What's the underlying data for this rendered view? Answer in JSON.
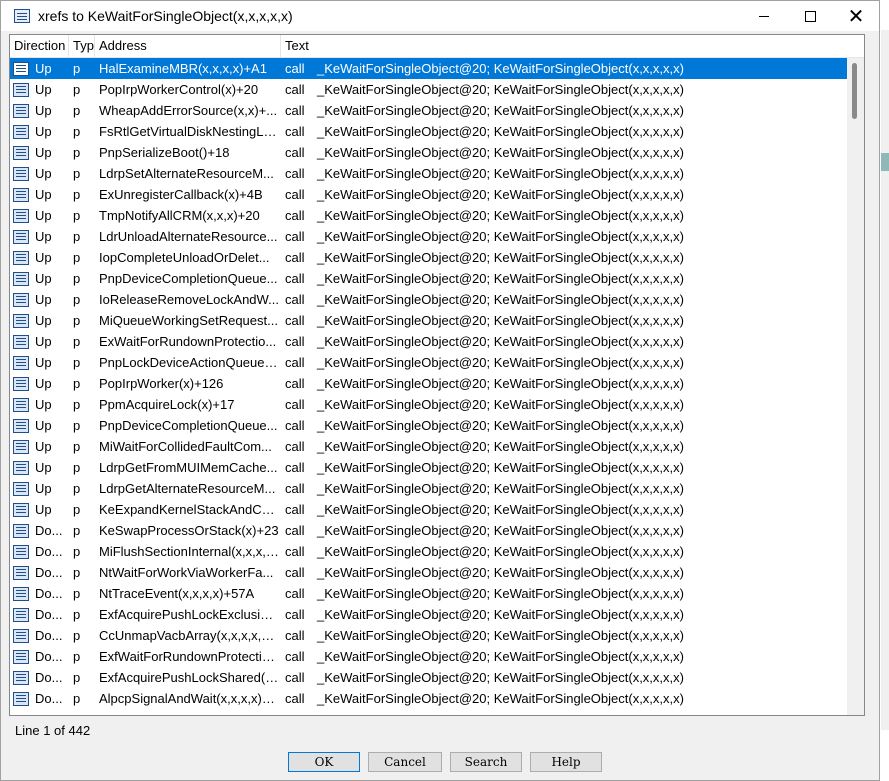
{
  "window": {
    "title": "xrefs to KeWaitForSingleObject(x,x,x,x,x)"
  },
  "columns": {
    "direction": "Direction",
    "type": "Typ",
    "address": "Address",
    "text": "Text"
  },
  "rows": [
    {
      "dir": "Up",
      "type": "p",
      "address": "HalExamineMBR(x,x,x,x)+A1",
      "kind": "call",
      "text": "_KeWaitForSingleObject@20; KeWaitForSingleObject(x,x,x,x,x)"
    },
    {
      "dir": "Up",
      "type": "p",
      "address": "PopIrpWorkerControl(x)+20",
      "kind": "call",
      "text": "_KeWaitForSingleObject@20; KeWaitForSingleObject(x,x,x,x,x)"
    },
    {
      "dir": "Up",
      "type": "p",
      "address": "WheapAddErrorSource(x,x)+...",
      "kind": "call",
      "text": "_KeWaitForSingleObject@20; KeWaitForSingleObject(x,x,x,x,x)"
    },
    {
      "dir": "Up",
      "type": "p",
      "address": "FsRtlGetVirtualDiskNestingLe...",
      "kind": "call",
      "text": "_KeWaitForSingleObject@20; KeWaitForSingleObject(x,x,x,x,x)"
    },
    {
      "dir": "Up",
      "type": "p",
      "address": "PnpSerializeBoot()+18",
      "kind": "call",
      "text": "_KeWaitForSingleObject@20; KeWaitForSingleObject(x,x,x,x,x)"
    },
    {
      "dir": "Up",
      "type": "p",
      "address": "LdrpSetAlternateResourceM...",
      "kind": "call",
      "text": "_KeWaitForSingleObject@20; KeWaitForSingleObject(x,x,x,x,x)"
    },
    {
      "dir": "Up",
      "type": "p",
      "address": "ExUnregisterCallback(x)+4B",
      "kind": "call",
      "text": "_KeWaitForSingleObject@20; KeWaitForSingleObject(x,x,x,x,x)"
    },
    {
      "dir": "Up",
      "type": "p",
      "address": "TmpNotifyAllCRM(x,x,x)+20",
      "kind": "call",
      "text": "_KeWaitForSingleObject@20; KeWaitForSingleObject(x,x,x,x,x)"
    },
    {
      "dir": "Up",
      "type": "p",
      "address": "LdrUnloadAlternateResource...",
      "kind": "call",
      "text": "_KeWaitForSingleObject@20; KeWaitForSingleObject(x,x,x,x,x)"
    },
    {
      "dir": "Up",
      "type": "p",
      "address": "IopCompleteUnloadOrDelet...",
      "kind": "call",
      "text": "_KeWaitForSingleObject@20; KeWaitForSingleObject(x,x,x,x,x)"
    },
    {
      "dir": "Up",
      "type": "p",
      "address": "PnpDeviceCompletionQueue...",
      "kind": "call",
      "text": "_KeWaitForSingleObject@20; KeWaitForSingleObject(x,x,x,x,x)"
    },
    {
      "dir": "Up",
      "type": "p",
      "address": "IoReleaseRemoveLockAndW...",
      "kind": "call",
      "text": "_KeWaitForSingleObject@20; KeWaitForSingleObject(x,x,x,x,x)"
    },
    {
      "dir": "Up",
      "type": "p",
      "address": "MiQueueWorkingSetRequest...",
      "kind": "call",
      "text": "_KeWaitForSingleObject@20; KeWaitForSingleObject(x,x,x,x,x)"
    },
    {
      "dir": "Up",
      "type": "p",
      "address": "ExWaitForRundownProtectio...",
      "kind": "call",
      "text": "_KeWaitForSingleObject@20; KeWaitForSingleObject(x,x,x,x,x)"
    },
    {
      "dir": "Up",
      "type": "p",
      "address": "PnpLockDeviceActionQueue(...",
      "kind": "call",
      "text": "_KeWaitForSingleObject@20; KeWaitForSingleObject(x,x,x,x,x)"
    },
    {
      "dir": "Up",
      "type": "p",
      "address": "PopIrpWorker(x)+126",
      "kind": "call",
      "text": "_KeWaitForSingleObject@20; KeWaitForSingleObject(x,x,x,x,x)"
    },
    {
      "dir": "Up",
      "type": "p",
      "address": "PpmAcquireLock(x)+17",
      "kind": "call",
      "text": "_KeWaitForSingleObject@20; KeWaitForSingleObject(x,x,x,x,x)"
    },
    {
      "dir": "Up",
      "type": "p",
      "address": "PnpDeviceCompletionQueue...",
      "kind": "call",
      "text": "_KeWaitForSingleObject@20; KeWaitForSingleObject(x,x,x,x,x)"
    },
    {
      "dir": "Up",
      "type": "p",
      "address": "MiWaitForCollidedFaultCom...",
      "kind": "call",
      "text": "_KeWaitForSingleObject@20; KeWaitForSingleObject(x,x,x,x,x)"
    },
    {
      "dir": "Up",
      "type": "p",
      "address": "LdrpGetFromMUIMemCache...",
      "kind": "call",
      "text": "_KeWaitForSingleObject@20; KeWaitForSingleObject(x,x,x,x,x)"
    },
    {
      "dir": "Up",
      "type": "p",
      "address": "LdrpGetAlternateResourceM...",
      "kind": "call",
      "text": "_KeWaitForSingleObject@20; KeWaitForSingleObject(x,x,x,x,x)"
    },
    {
      "dir": "Up",
      "type": "p",
      "address": "KeExpandKernelStackAndCal...",
      "kind": "call",
      "text": "_KeWaitForSingleObject@20; KeWaitForSingleObject(x,x,x,x,x)"
    },
    {
      "dir": "Do...",
      "type": "p",
      "address": "KeSwapProcessOrStack(x)+23",
      "kind": "call",
      "text": "_KeWaitForSingleObject@20; KeWaitForSingleObject(x,x,x,x,x)"
    },
    {
      "dir": "Do...",
      "type": "p",
      "address": "MiFlushSectionInternal(x,x,x,x...",
      "kind": "call",
      "text": "_KeWaitForSingleObject@20; KeWaitForSingleObject(x,x,x,x,x)"
    },
    {
      "dir": "Do...",
      "type": "p",
      "address": "NtWaitForWorkViaWorkerFa...",
      "kind": "call",
      "text": "_KeWaitForSingleObject@20; KeWaitForSingleObject(x,x,x,x,x)"
    },
    {
      "dir": "Do...",
      "type": "p",
      "address": "NtTraceEvent(x,x,x,x)+57A",
      "kind": "call",
      "text": "_KeWaitForSingleObject@20; KeWaitForSingleObject(x,x,x,x,x)"
    },
    {
      "dir": "Do...",
      "type": "p",
      "address": "ExfAcquirePushLockExclusive...",
      "kind": "call",
      "text": "_KeWaitForSingleObject@20; KeWaitForSingleObject(x,x,x,x,x)"
    },
    {
      "dir": "Do...",
      "type": "p",
      "address": "CcUnmapVacbArray(x,x,x,x,x)...",
      "kind": "call",
      "text": "_KeWaitForSingleObject@20; KeWaitForSingleObject(x,x,x,x,x)"
    },
    {
      "dir": "Do...",
      "type": "p",
      "address": "ExfWaitForRundownProtectio...",
      "kind": "call",
      "text": "_KeWaitForSingleObject@20; KeWaitForSingleObject(x,x,x,x,x)"
    },
    {
      "dir": "Do...",
      "type": "p",
      "address": "ExfAcquirePushLockShared(x)...",
      "kind": "call",
      "text": "_KeWaitForSingleObject@20; KeWaitForSingleObject(x,x,x,x,x)"
    },
    {
      "dir": "Do...",
      "type": "p",
      "address": "AlpcpSignalAndWait(x,x,x,x)+...",
      "kind": "call",
      "text": "_KeWaitForSingleObject@20; KeWaitForSingleObject(x,x,x,x,x)"
    }
  ],
  "status": {
    "line_text": "Line 1 of 442"
  },
  "buttons": {
    "ok": "OK",
    "cancel": "Cancel",
    "search": "Search",
    "help": "Help"
  },
  "colors": {
    "selection": "#0078d7",
    "background": "#f0f0f0",
    "button_face": "#e1e1e1"
  }
}
